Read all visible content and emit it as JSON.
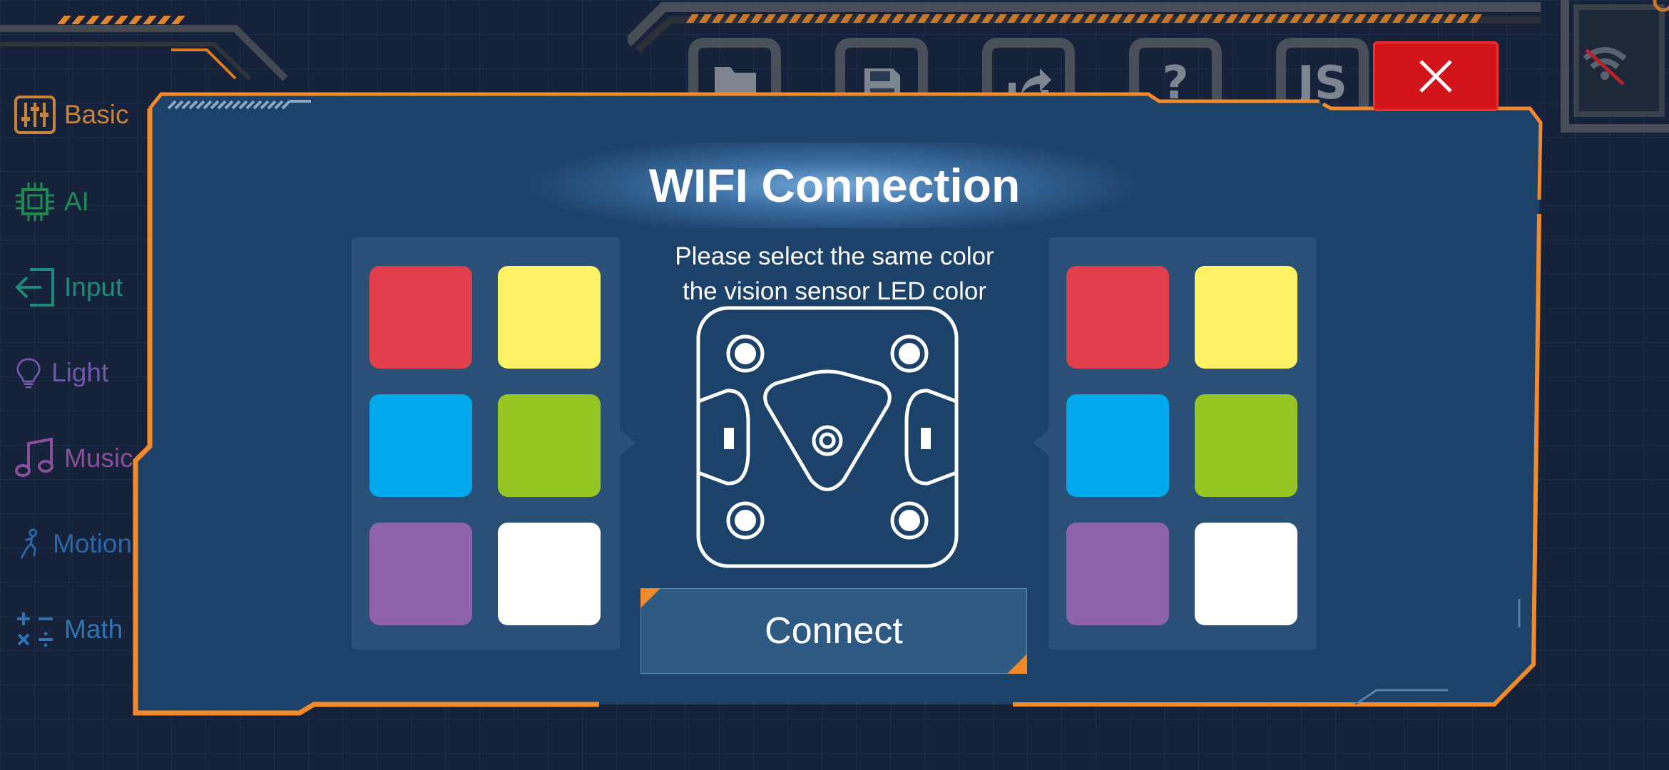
{
  "sidebar": {
    "items": [
      {
        "label": "Basic",
        "icon": "sliders-icon",
        "color": "#c7843a"
      },
      {
        "label": "AI",
        "icon": "chip-icon",
        "color": "#1f8a52"
      },
      {
        "label": "Input",
        "icon": "input-icon",
        "color": "#1e8a78"
      },
      {
        "label": "Light",
        "icon": "bulb-icon",
        "color": "#7057a8"
      },
      {
        "label": "Music",
        "icon": "music-icon",
        "color": "#8a4e9a"
      },
      {
        "label": "Motion",
        "icon": "motion-icon",
        "color": "#2c66a8"
      },
      {
        "label": "Math",
        "icon": "math-icon",
        "color": "#2f73b0"
      }
    ]
  },
  "toolbar": {
    "buttons": [
      "folder-icon",
      "save-icon",
      "share-icon",
      "help-icon",
      "js-icon"
    ],
    "help_label": "?",
    "js_label": "JS"
  },
  "modal": {
    "title": "WIFI Connection",
    "instruction_line1": "Please select the same color",
    "instruction_line2": "the vision sensor LED color",
    "connect_label": "Connect",
    "colors": [
      "#e13f4c",
      "#fdf266",
      "#00a9eb",
      "#95c623",
      "#8f63ac",
      "#ffffff"
    ],
    "accent": "#f28a2a",
    "close_color": "#d2141b"
  }
}
